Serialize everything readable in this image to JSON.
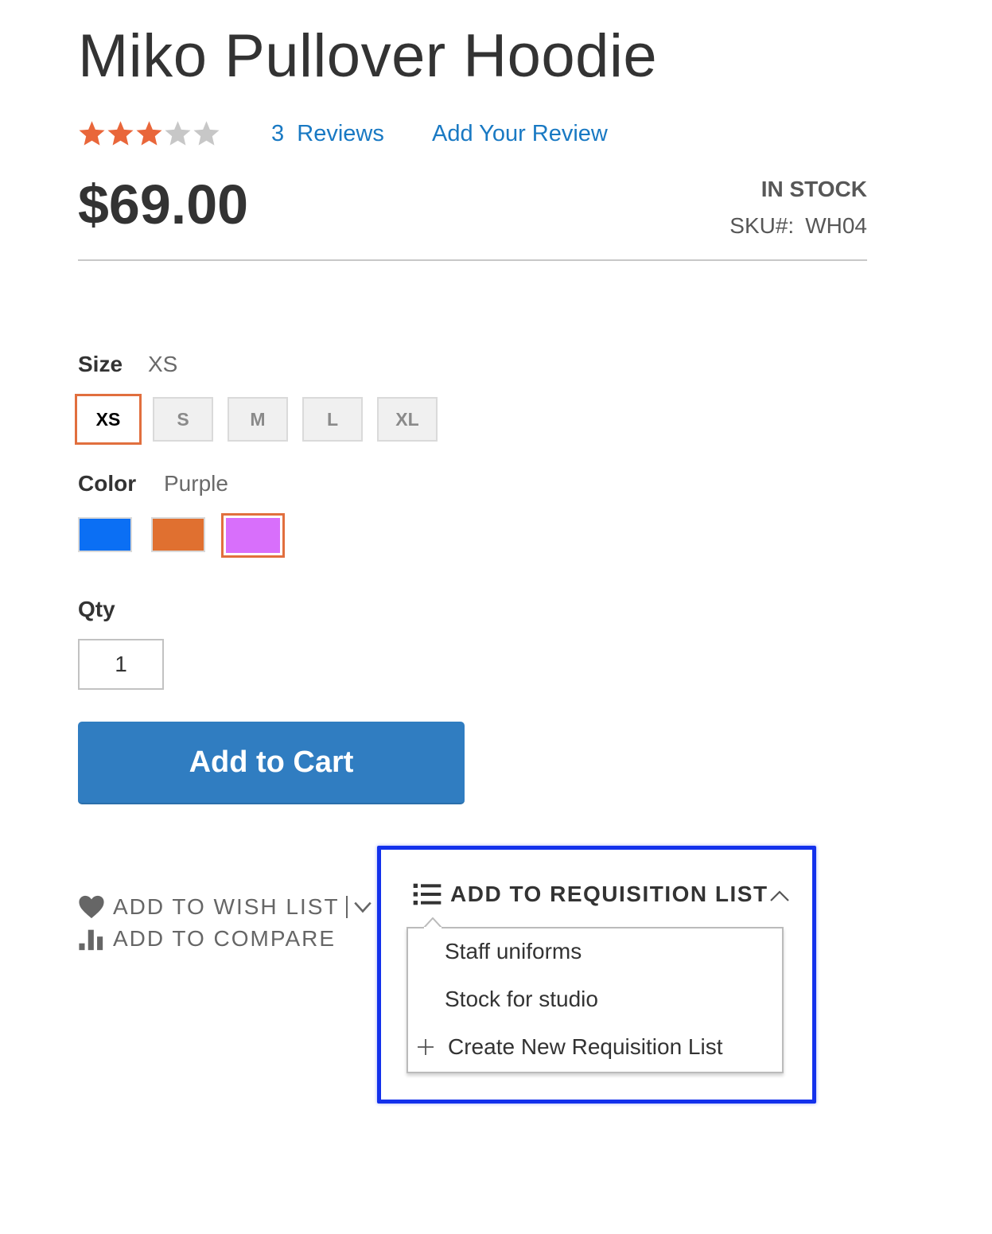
{
  "product": {
    "title": "Miko Pullover Hoodie",
    "rating_stars_filled": 3,
    "rating_stars_total": 5,
    "reviews_count": "3",
    "reviews_label": "Reviews",
    "add_review_label": "Add Your Review",
    "price": "$69.00",
    "stock_status": "IN STOCK",
    "sku_label": "SKU#:",
    "sku_value": "WH04"
  },
  "options": {
    "size_label": "Size",
    "size_selected": "XS",
    "sizes": [
      "XS",
      "S",
      "M",
      "L",
      "XL"
    ],
    "color_label": "Color",
    "color_selected": "Purple",
    "colors": [
      {
        "name": "Blue",
        "hex": "#0b6ff4"
      },
      {
        "name": "Orange",
        "hex": "#e07030"
      },
      {
        "name": "Purple",
        "hex": "#d86ffb"
      }
    ]
  },
  "qty": {
    "label": "Qty",
    "value": "1"
  },
  "cart": {
    "add_to_cart_label": "Add to Cart"
  },
  "actions": {
    "wishlist_label": "ADD TO WISH LIST",
    "compare_label": "ADD TO COMPARE"
  },
  "requisition": {
    "toggle_label": "ADD TO REQUISITION LIST",
    "lists": [
      "Staff uniforms",
      "Stock for studio"
    ],
    "create_label": "Create New Requisition List"
  },
  "colors": {
    "accent_link": "#1979c3",
    "star_filled": "#e9663a",
    "star_empty": "#c7c7c7",
    "selected_border": "#e16f3e",
    "button_primary": "#307dc1",
    "highlight": "#1331ec"
  }
}
